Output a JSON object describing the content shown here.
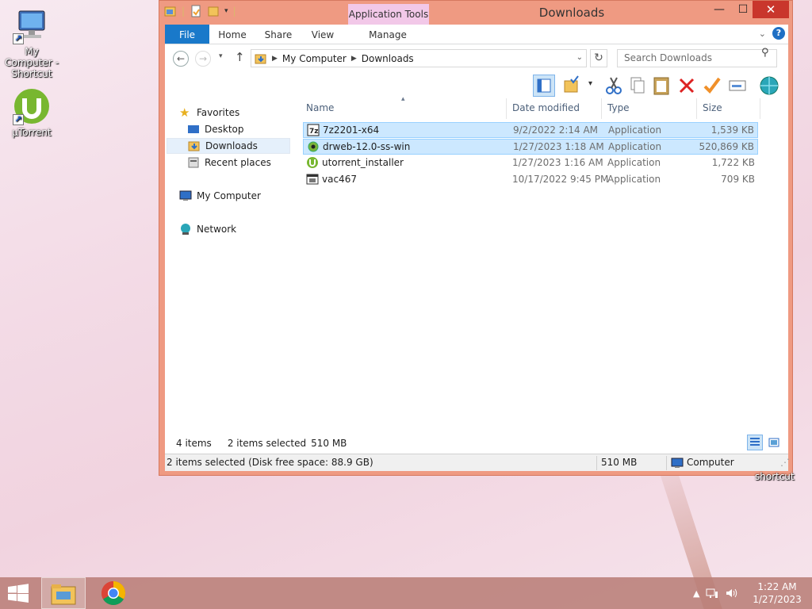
{
  "desktop": {
    "icons": [
      {
        "label": "My Computer - Shortcut"
      },
      {
        "label": "µTorrent"
      }
    ],
    "stray_label": "shortcut"
  },
  "window": {
    "title": "Downloads",
    "context_tab": "Application Tools",
    "ribbon_tabs": {
      "file": "File",
      "home": "Home",
      "share": "Share",
      "view": "View",
      "manage": "Manage"
    },
    "address": {
      "segments": [
        "My Computer",
        "Downloads"
      ]
    },
    "search": {
      "placeholder": "Search Downloads"
    },
    "nav_pane": {
      "favorites": "Favorites",
      "desktop": "Desktop",
      "downloads": "Downloads",
      "recent": "Recent places",
      "computer": "My Computer",
      "network": "Network"
    },
    "columns": {
      "name": "Name",
      "date": "Date modified",
      "type": "Type",
      "size": "Size"
    },
    "files": [
      {
        "name": "7z2201-x64",
        "date": "9/2/2022 2:14 AM",
        "type": "Application",
        "size": "1,539 KB",
        "selected": true
      },
      {
        "name": "drweb-12.0-ss-win",
        "date": "1/27/2023 1:18 AM",
        "type": "Application",
        "size": "520,869 KB",
        "selected": true
      },
      {
        "name": "utorrent_installer",
        "date": "1/27/2023 1:16 AM",
        "type": "Application",
        "size": "1,722 KB",
        "selected": false
      },
      {
        "name": "vac467",
        "date": "10/17/2022 9:45 PM",
        "type": "Application",
        "size": "709 KB",
        "selected": false
      }
    ],
    "status_line": {
      "count": "4 items",
      "selected": "2 items selected",
      "size": "510 MB"
    },
    "status_bar": {
      "info": "2 items selected (Disk free space: 88.9 GB)",
      "size": "510 MB",
      "location": "Computer"
    }
  },
  "taskbar": {
    "clock_time": "1:22 AM",
    "clock_date": "1/27/2023"
  },
  "colors": {
    "accent": "#1979ca",
    "window_border": "#ef9a82",
    "selection": "#cce8ff",
    "close": "#c9362c"
  }
}
